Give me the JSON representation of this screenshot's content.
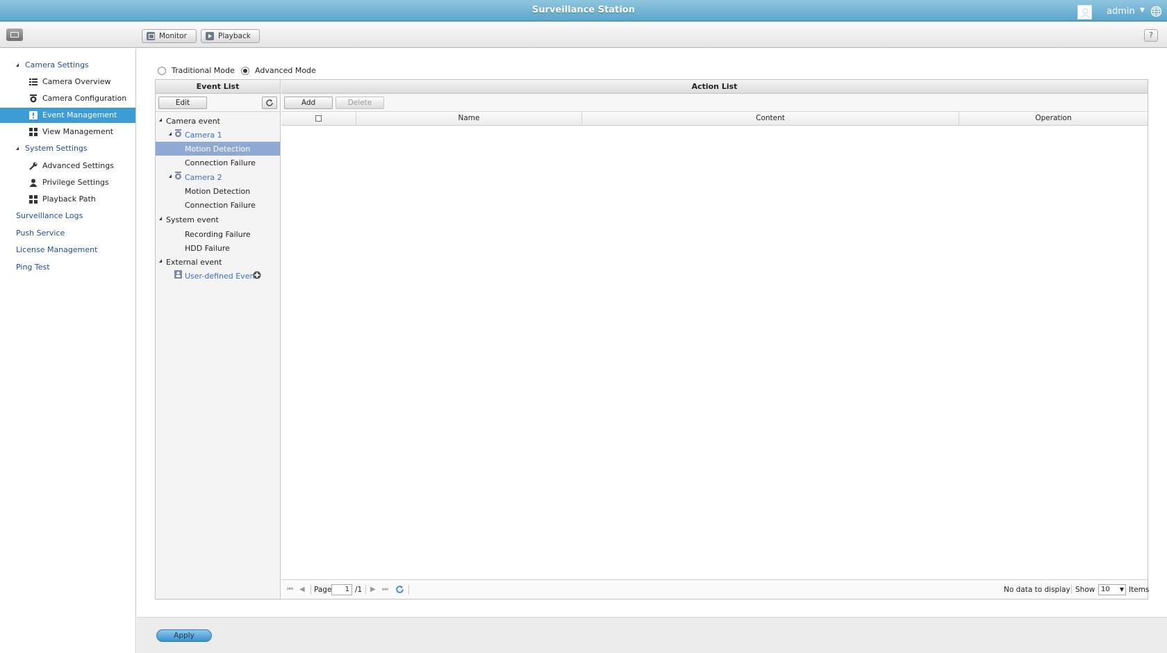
{
  "app": {
    "title": "Surveillance Station",
    "user": "admin"
  },
  "toolbar": {
    "monitor_label": "Monitor",
    "playback_label": "Playback",
    "help_label": "?"
  },
  "sidebar": {
    "camera_settings": "Camera Settings",
    "camera_overview": "Camera Overview",
    "camera_configuration": "Camera Configuration",
    "event_management": "Event Management",
    "view_management": "View Management",
    "system_settings": "System Settings",
    "advanced_settings": "Advanced Settings",
    "privilege_settings": "Privilege Settings",
    "playback_path": "Playback Path",
    "surveillance_logs": "Surveillance Logs",
    "push_service": "Push Service",
    "license_management": "License Management",
    "ping_test": "Ping Test"
  },
  "mode": {
    "traditional": "Traditional Mode",
    "advanced": "Advanced Mode",
    "selected": "advanced"
  },
  "event_list": {
    "header": "Event List",
    "edit_label": "Edit",
    "camera_event": "Camera event",
    "camera1": "Camera 1",
    "camera2": "Camera 2",
    "motion_detection": "Motion Detection",
    "connection_failure": "Connection Failure",
    "system_event": "System event",
    "recording_failure": "Recording Failure",
    "hdd_failure": "HDD Failure",
    "external_event": "External event",
    "user_defined_event": "User-defined Event"
  },
  "action_list": {
    "header": "Action List",
    "add_label": "Add",
    "delete_label": "Delete",
    "columns": {
      "name": "Name",
      "content": "Content",
      "operation": "Operation"
    }
  },
  "pager": {
    "page_label": "Page",
    "page_value": "1",
    "page_total": "/1",
    "status": "No data to display",
    "show_label": "Show",
    "show_value": "10",
    "items_label": "Items"
  },
  "footer": {
    "apply_label": "Apply"
  },
  "colors": {
    "accent": "#3d9cd6",
    "titlebar": "#6fb1d3",
    "selection": "#8fa9d3"
  }
}
